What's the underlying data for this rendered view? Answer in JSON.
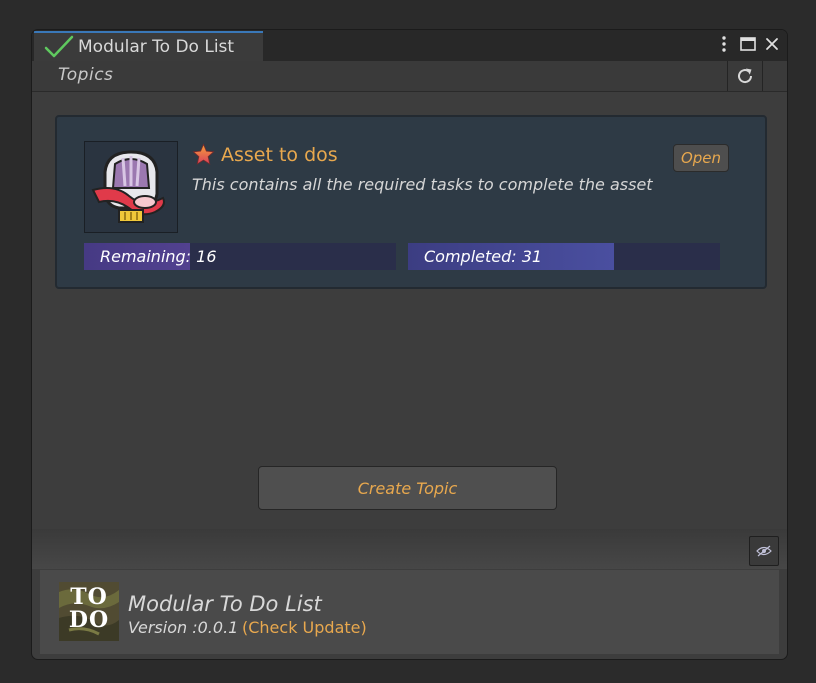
{
  "window": {
    "tab_title": "Modular To Do List",
    "controls": [
      "more-icon",
      "maximize-icon",
      "close-icon"
    ]
  },
  "toolbar": {
    "topics_label": "Topics",
    "refresh_icon": "refresh-icon"
  },
  "topics": [
    {
      "title": "Asset to dos",
      "description": "This contains all the required tasks to complete the asset",
      "open_label": "Open",
      "starred": true,
      "remaining_label": "Remaining: 16",
      "completed_label": "Completed: 31",
      "remaining": 16,
      "completed": 31
    }
  ],
  "actions": {
    "create_topic_label": "Create Topic"
  },
  "footer": {
    "logo_text": "TO DO",
    "app_name": "Modular To Do List",
    "version": "Version :0.0.1",
    "check_update": "(Check Update)",
    "visibility_icon": "eye-hidden-icon"
  },
  "colors": {
    "accent": "#e8a84e",
    "tab_highlight": "#3a78b8",
    "check_green": "#5fc95f",
    "card_bg": "#2e3a45",
    "progress_fill": "#4a4fa0"
  }
}
